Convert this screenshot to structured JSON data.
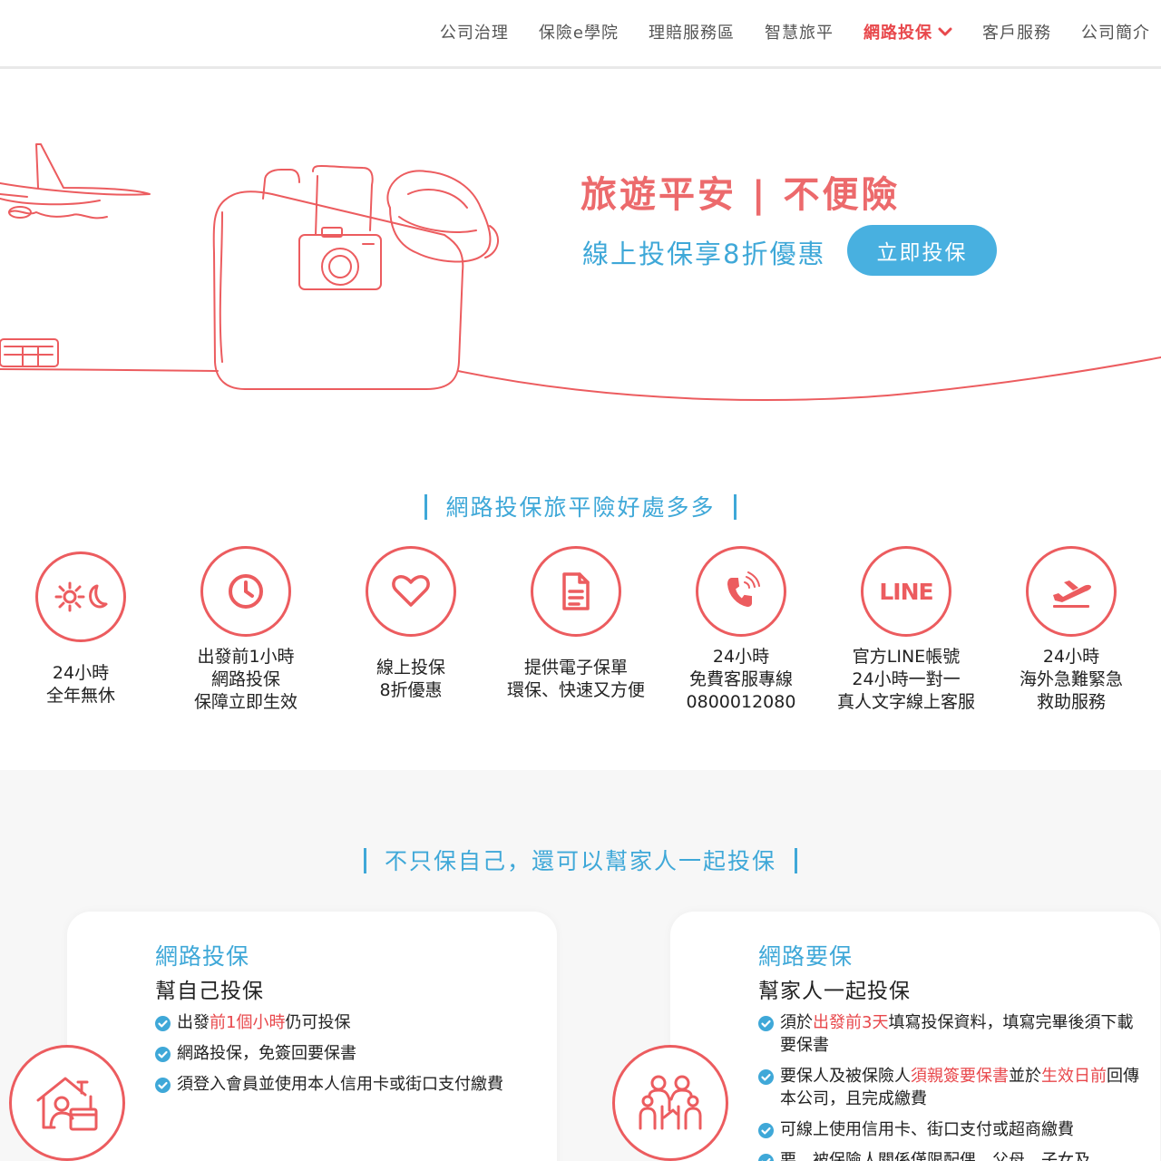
{
  "nav": {
    "items": [
      {
        "label": "公司治理"
      },
      {
        "label": "保險e學院"
      },
      {
        "label": "理賠服務區"
      },
      {
        "label": "智慧旅平"
      },
      {
        "label": "網路投保"
      },
      {
        "label": "客戶服務"
      },
      {
        "label": "公司簡介"
      }
    ],
    "active_index": 4
  },
  "hero": {
    "title": "旅遊平安 | 不便險",
    "subtitle": "線上投保享8折優惠",
    "cta_label": "立即投保"
  },
  "benefits": {
    "title": "網路投保旅平險好處多多",
    "items": [
      {
        "icon": "gear-moon-icon",
        "lines": [
          "24小時",
          "全年無休"
        ]
      },
      {
        "icon": "clock-icon",
        "lines": [
          "出發前1小時",
          "網路投保",
          "保障立即生效"
        ]
      },
      {
        "icon": "heart-icon",
        "lines": [
          "線上投保",
          "8折優惠"
        ]
      },
      {
        "icon": "document-icon",
        "lines": [
          "提供電子保單",
          "環保、快速又方便"
        ]
      },
      {
        "icon": "phone-icon",
        "lines": [
          "24小時",
          "免費客服專線",
          "0800012080"
        ]
      },
      {
        "icon": "line-icon",
        "icon_text": "LINE",
        "lines": [
          "官方LINE帳號",
          "24小時一對一",
          "真人文字線上客服"
        ]
      },
      {
        "icon": "airplane-takeoff-icon",
        "lines": [
          "24小時",
          "海外急難緊急",
          "救助服務"
        ]
      }
    ]
  },
  "family": {
    "title": "不只保自己，還可以幫家人一起投保",
    "cards": [
      {
        "title": "網路投保",
        "subtitle": "幫自己投保",
        "icon": "house-person-icon",
        "bullets": [
          [
            {
              "t": "出發"
            },
            {
              "t": "前1個小時",
              "hl": true
            },
            {
              "t": "仍可投保"
            }
          ],
          [
            {
              "t": "網路投保，免簽回要保書"
            }
          ],
          [
            {
              "t": "須登入會員並使用本人信用卡或街口支付繳費"
            }
          ]
        ]
      },
      {
        "title": "網路要保",
        "subtitle": "幫家人一起投保",
        "icon": "family-icon",
        "bullets": [
          [
            {
              "t": "須於"
            },
            {
              "t": "出發前3天",
              "hl": true
            },
            {
              "t": "填寫投保資料，填寫完畢後須下載要保書"
            }
          ],
          [
            {
              "t": "要保人及被保險人"
            },
            {
              "t": "須親簽要保書",
              "hl": true
            },
            {
              "t": "並於"
            },
            {
              "t": "生效日前",
              "hl": true
            },
            {
              "t": "回傳本公司，且完成繳費"
            }
          ],
          [
            {
              "t": "可線上使用信用卡、街口支付或超商繳費"
            }
          ],
          [
            {
              "t": "要、被保險人關係僅限配偶、父母、子女及"
            }
          ]
        ]
      }
    ]
  },
  "colors": {
    "accent_red": "#ec5c5f",
    "accent_blue": "#3fa8d8",
    "button_blue": "#48b0e0"
  }
}
